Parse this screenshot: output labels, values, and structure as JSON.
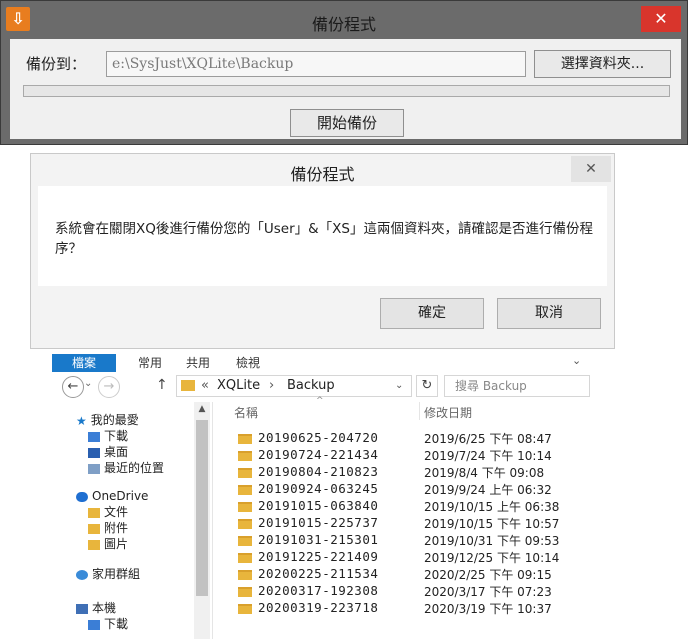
{
  "backup_window": {
    "title": "備份程式",
    "app_icon": "download-arrow-icon",
    "close_glyph": "✕",
    "label": "備份到：",
    "path_value": "e:\\SysJust\\XQLite\\Backup",
    "browse_button": "選擇資料夾...",
    "progress": 0,
    "start_button": "開始備份",
    "colors": {
      "title_bg": "#6b6b6b",
      "close_bg": "#d9352c",
      "body_bg": "#f0f0f0"
    }
  },
  "confirm_dialog": {
    "title": "備份程式",
    "close_glyph": "✕",
    "message": "系統會在關閉XQ後進行備份您的「User」&「XS」這兩個資料夾，請確認是否進行備份程序？",
    "ok_button": "確定",
    "cancel_button": "取消"
  },
  "explorer": {
    "tabs": [
      "檔案",
      "常用",
      "共用",
      "檢視"
    ],
    "active_tab": "檔案",
    "breadcrumb": [
      "XQLite",
      "Backup"
    ],
    "breadcrumb_sep": "«",
    "breadcrumb_arrow": "›",
    "search_placeholder": "搜尋 Backup",
    "nav": {
      "quick_access": {
        "label": "我的最愛",
        "icon": "star-icon",
        "items": [
          "下載",
          "桌面",
          "最近的位置"
        ]
      },
      "onedrive": {
        "label": "OneDrive",
        "icon": "cloud-icon",
        "items": [
          "文件",
          "附件",
          "圖片"
        ]
      },
      "homegroup": {
        "label": "家用群組",
        "icon": "homegroup-icon"
      },
      "this_pc": {
        "label": "本機",
        "icon": "computer-icon",
        "items": [
          "下載"
        ]
      }
    },
    "columns": {
      "name": "名稱",
      "date": "修改日期"
    },
    "files": [
      {
        "name": "20190625-204720",
        "date": "2019/6/25 下午 08:47"
      },
      {
        "name": "20190724-221434",
        "date": "2019/7/24 下午 10:14"
      },
      {
        "name": "20190804-210823",
        "date": "2019/8/4 下午 09:08"
      },
      {
        "name": "20190924-063245",
        "date": "2019/9/24 上午 06:32"
      },
      {
        "name": "20191015-063840",
        "date": "2019/10/15 上午 06:38"
      },
      {
        "name": "20191015-225737",
        "date": "2019/10/15 下午 10:57"
      },
      {
        "name": "20191031-215301",
        "date": "2019/10/31 下午 09:53"
      },
      {
        "name": "20191225-221409",
        "date": "2019/12/25 下午 10:14"
      },
      {
        "name": "20200225-211534",
        "date": "2020/2/25 下午 09:15"
      },
      {
        "name": "20200317-192308",
        "date": "2020/3/17 下午 07:23"
      },
      {
        "name": "20200319-223718",
        "date": "2020/3/19 下午 10:37"
      }
    ]
  }
}
